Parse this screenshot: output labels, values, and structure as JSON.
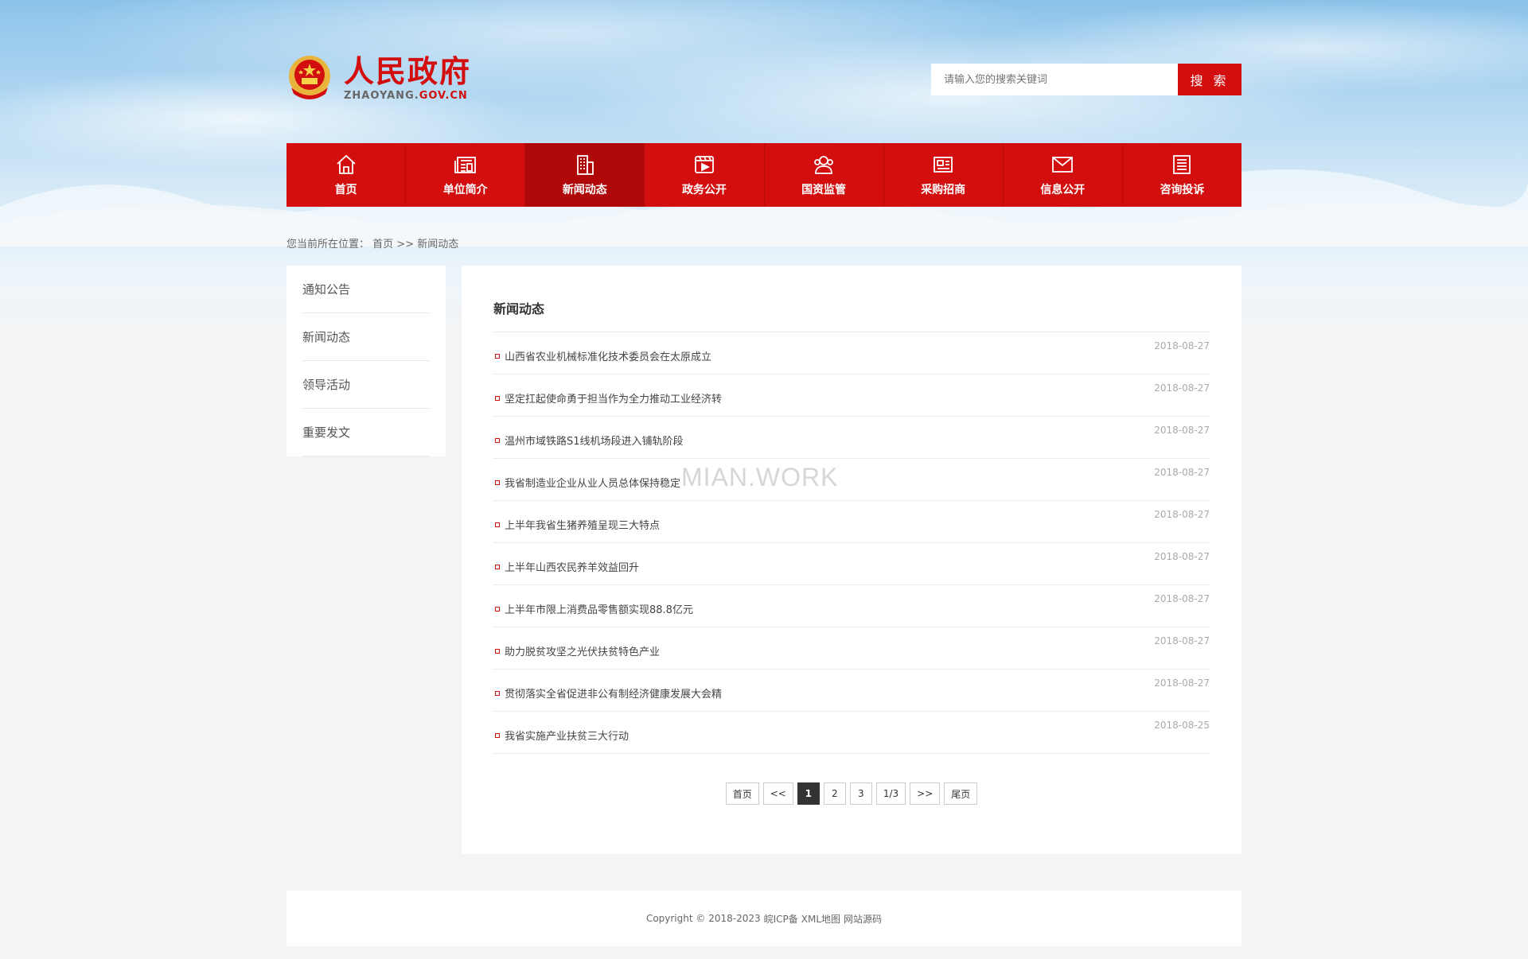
{
  "header": {
    "logo_title": "人民政府",
    "logo_sub_main": "ZHAOYANG.",
    "logo_sub_highlight": "GOV.CN",
    "search_placeholder": "请输入您的搜索关键词",
    "search_button": "搜 索"
  },
  "nav": {
    "items": [
      {
        "label": "首页",
        "icon": "home-icon"
      },
      {
        "label": "单位简介",
        "icon": "news-icon"
      },
      {
        "label": "新闻动态",
        "icon": "building-icon"
      },
      {
        "label": "政务公开",
        "icon": "video-icon"
      },
      {
        "label": "国资监管",
        "icon": "users-icon"
      },
      {
        "label": "采购招商",
        "icon": "card-icon"
      },
      {
        "label": "信息公开",
        "icon": "mail-icon"
      },
      {
        "label": "咨询投诉",
        "icon": "list-icon"
      }
    ],
    "active_index": 2
  },
  "breadcrumb": {
    "prefix": "您当前所在位置：",
    "home": "首页",
    "separator": ">>",
    "current": "新闻动态"
  },
  "sidebar": {
    "items": [
      "通知公告",
      "新闻动态",
      "领导活动",
      "重要发文"
    ]
  },
  "main": {
    "title": "新闻动态",
    "articles": [
      {
        "title": "山西省农业机械标准化技术委员会在太原成立",
        "date": "2018-08-27"
      },
      {
        "title": "坚定扛起使命勇于担当作为全力推动工业经济转",
        "date": "2018-08-27"
      },
      {
        "title": "温州市域铁路S1线机场段进入铺轨阶段",
        "date": "2018-08-27"
      },
      {
        "title": "我省制造业企业从业人员总体保持稳定",
        "date": "2018-08-27"
      },
      {
        "title": "上半年我省生猪养殖呈现三大特点",
        "date": "2018-08-27"
      },
      {
        "title": "上半年山西农民养羊效益回升",
        "date": "2018-08-27"
      },
      {
        "title": "上半年市限上消费品零售额实现88.8亿元",
        "date": "2018-08-27"
      },
      {
        "title": "助力脱贫攻坚之光伏扶贫特色产业",
        "date": "2018-08-27"
      },
      {
        "title": "贯彻落实全省促进非公有制经济健康发展大会精",
        "date": "2018-08-27"
      },
      {
        "title": "我省实施产业扶贫三大行动",
        "date": "2018-08-25"
      }
    ]
  },
  "pager": {
    "first": "首页",
    "prev": "<<",
    "pages": [
      "1",
      "2",
      "3"
    ],
    "current": "1",
    "info": "1/3",
    "next": ">>",
    "last": "尾页"
  },
  "watermark": "MIAN.WORK",
  "footer": {
    "copyright": "Copyright © 2018-2023",
    "icp": "皖ICP备",
    "xml": "XML地图",
    "source": "网站源码"
  },
  "colors": {
    "brand_red": "#d20e0e",
    "nav_active": "#b00808"
  }
}
